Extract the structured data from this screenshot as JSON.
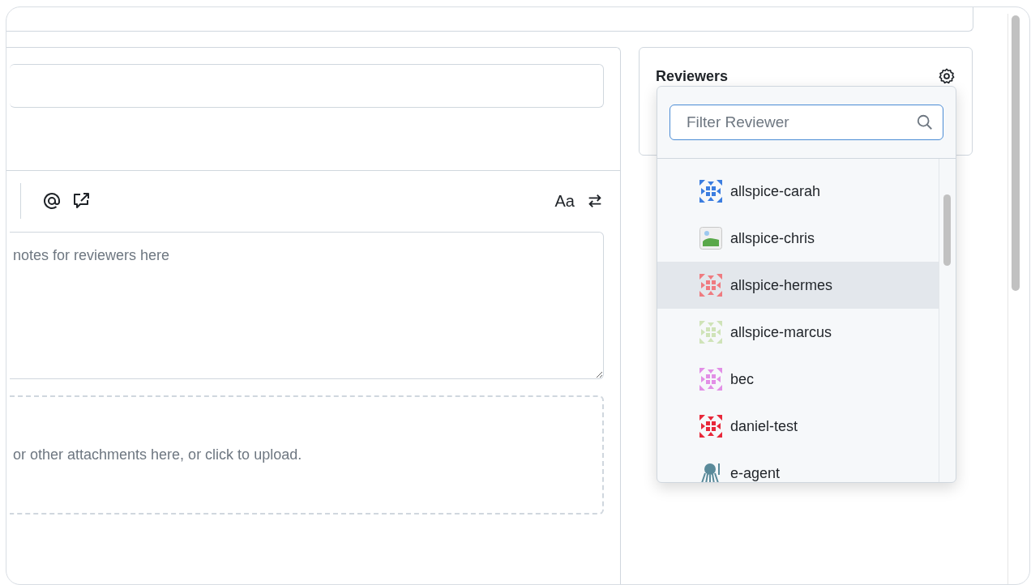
{
  "editor": {
    "toolbar_right_label": "Aa",
    "description_placeholder": "notes for reviewers here",
    "dropzone_text": "or other attachments here, or click to upload."
  },
  "sidebar": {
    "title": "Reviewers"
  },
  "reviewer_dropdown": {
    "filter_placeholder": "Filter Reviewer",
    "items": [
      {
        "name": "allspice-carah",
        "kind": "identicon",
        "color": "#3b7de0",
        "highlighted": false
      },
      {
        "name": "allspice-chris",
        "kind": "broken-image",
        "color": "#5aa84a",
        "highlighted": false
      },
      {
        "name": "allspice-hermes",
        "kind": "identicon",
        "color": "#ef7b80",
        "highlighted": true
      },
      {
        "name": "allspice-marcus",
        "kind": "identicon",
        "color": "#cfe3b8",
        "highlighted": false
      },
      {
        "name": "bec",
        "kind": "identicon",
        "color": "#e28fe6",
        "highlighted": false
      },
      {
        "name": "daniel-test",
        "kind": "identicon",
        "color": "#e8283a",
        "highlighted": false
      },
      {
        "name": "e-agent",
        "kind": "photo",
        "color": "#5a8a9a",
        "highlighted": false
      }
    ]
  }
}
